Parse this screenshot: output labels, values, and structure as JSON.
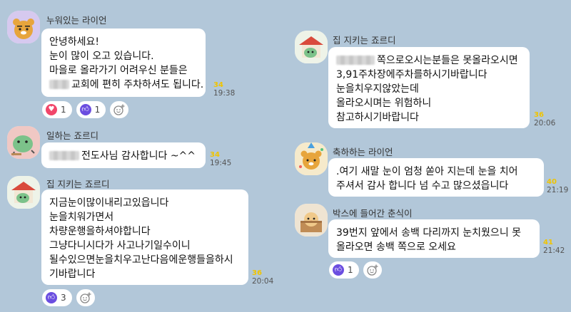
{
  "colors": {
    "background": "#b2c7d9",
    "bubble": "#ffffff",
    "read_count": "#f0c400",
    "heart": "#f1466a",
    "like": "#6b4ee0"
  },
  "messages": [
    {
      "sender": "누워있는 라이언",
      "avatar_icon": "ryan-lying-icon",
      "lines": [
        "안녕하세요!",
        "눈이 많이 오고 있습니다.",
        "마을로 올라가기 어려우신 분들은",
        "교회에 편히 주차하셔도 됩니다."
      ],
      "redacted_prefix_line": 3,
      "read_count": "34",
      "time": "19:38",
      "reactions": [
        {
          "type": "heart",
          "count": "1"
        },
        {
          "type": "like",
          "count": "1"
        }
      ]
    },
    {
      "sender": "일하는 죠르디",
      "avatar_icon": "jordy-working-icon",
      "lines": [
        "전도사님 감사합니다 ~^^"
      ],
      "redacted_prefix_line": 0,
      "read_count": "34",
      "time": "19:45"
    },
    {
      "sender": "집 지키는 죠르디",
      "avatar_icon": "jordy-house-icon",
      "lines": [
        "지금눈이많이내리고있읍니다",
        "눈을치워가면서",
        "차량운행을하셔야합니다",
        "그냥다니시다가 사고나기일수이니",
        "될수있으면눈을치우고난다음에운행들을하시",
        "기바랍니다"
      ],
      "read_count": "36",
      "time": "20:04",
      "reactions": [
        {
          "type": "like",
          "count": "3"
        }
      ]
    },
    {
      "sender": "집 지키는 죠르디",
      "avatar_icon": "jordy-house-icon",
      "lines": [
        "쪽으로오시는분들은 못올라오시면",
        "3,91주차장에주차를하시기바랍니다",
        "눈을치우지않았는데",
        "올라오시며는 위험하니",
        "참고하시기바랍니다"
      ],
      "redacted_prefix_line": 0,
      "read_count": "36",
      "time": "20:06"
    },
    {
      "sender": "축하하는 라이언",
      "avatar_icon": "ryan-celebrating-icon",
      "lines": [
        ".여기 새말  눈이 엄청  쏟아  지는데 눈을 치어",
        "주셔서 감사 합니다  넘 수고 많으셨읍니다"
      ],
      "read_count": "40",
      "time": "21:19"
    },
    {
      "sender": "박스에 들어간 춘식이",
      "avatar_icon": "choonsik-box-icon",
      "lines": [
        "39번지 앞에서 송백 다리까지 눈치웠으니 못",
        "올라오면 송백 쪽으로 오세요"
      ],
      "read_count": "41",
      "time": "21:42",
      "reactions": [
        {
          "type": "like",
          "count": "1"
        }
      ]
    }
  ]
}
